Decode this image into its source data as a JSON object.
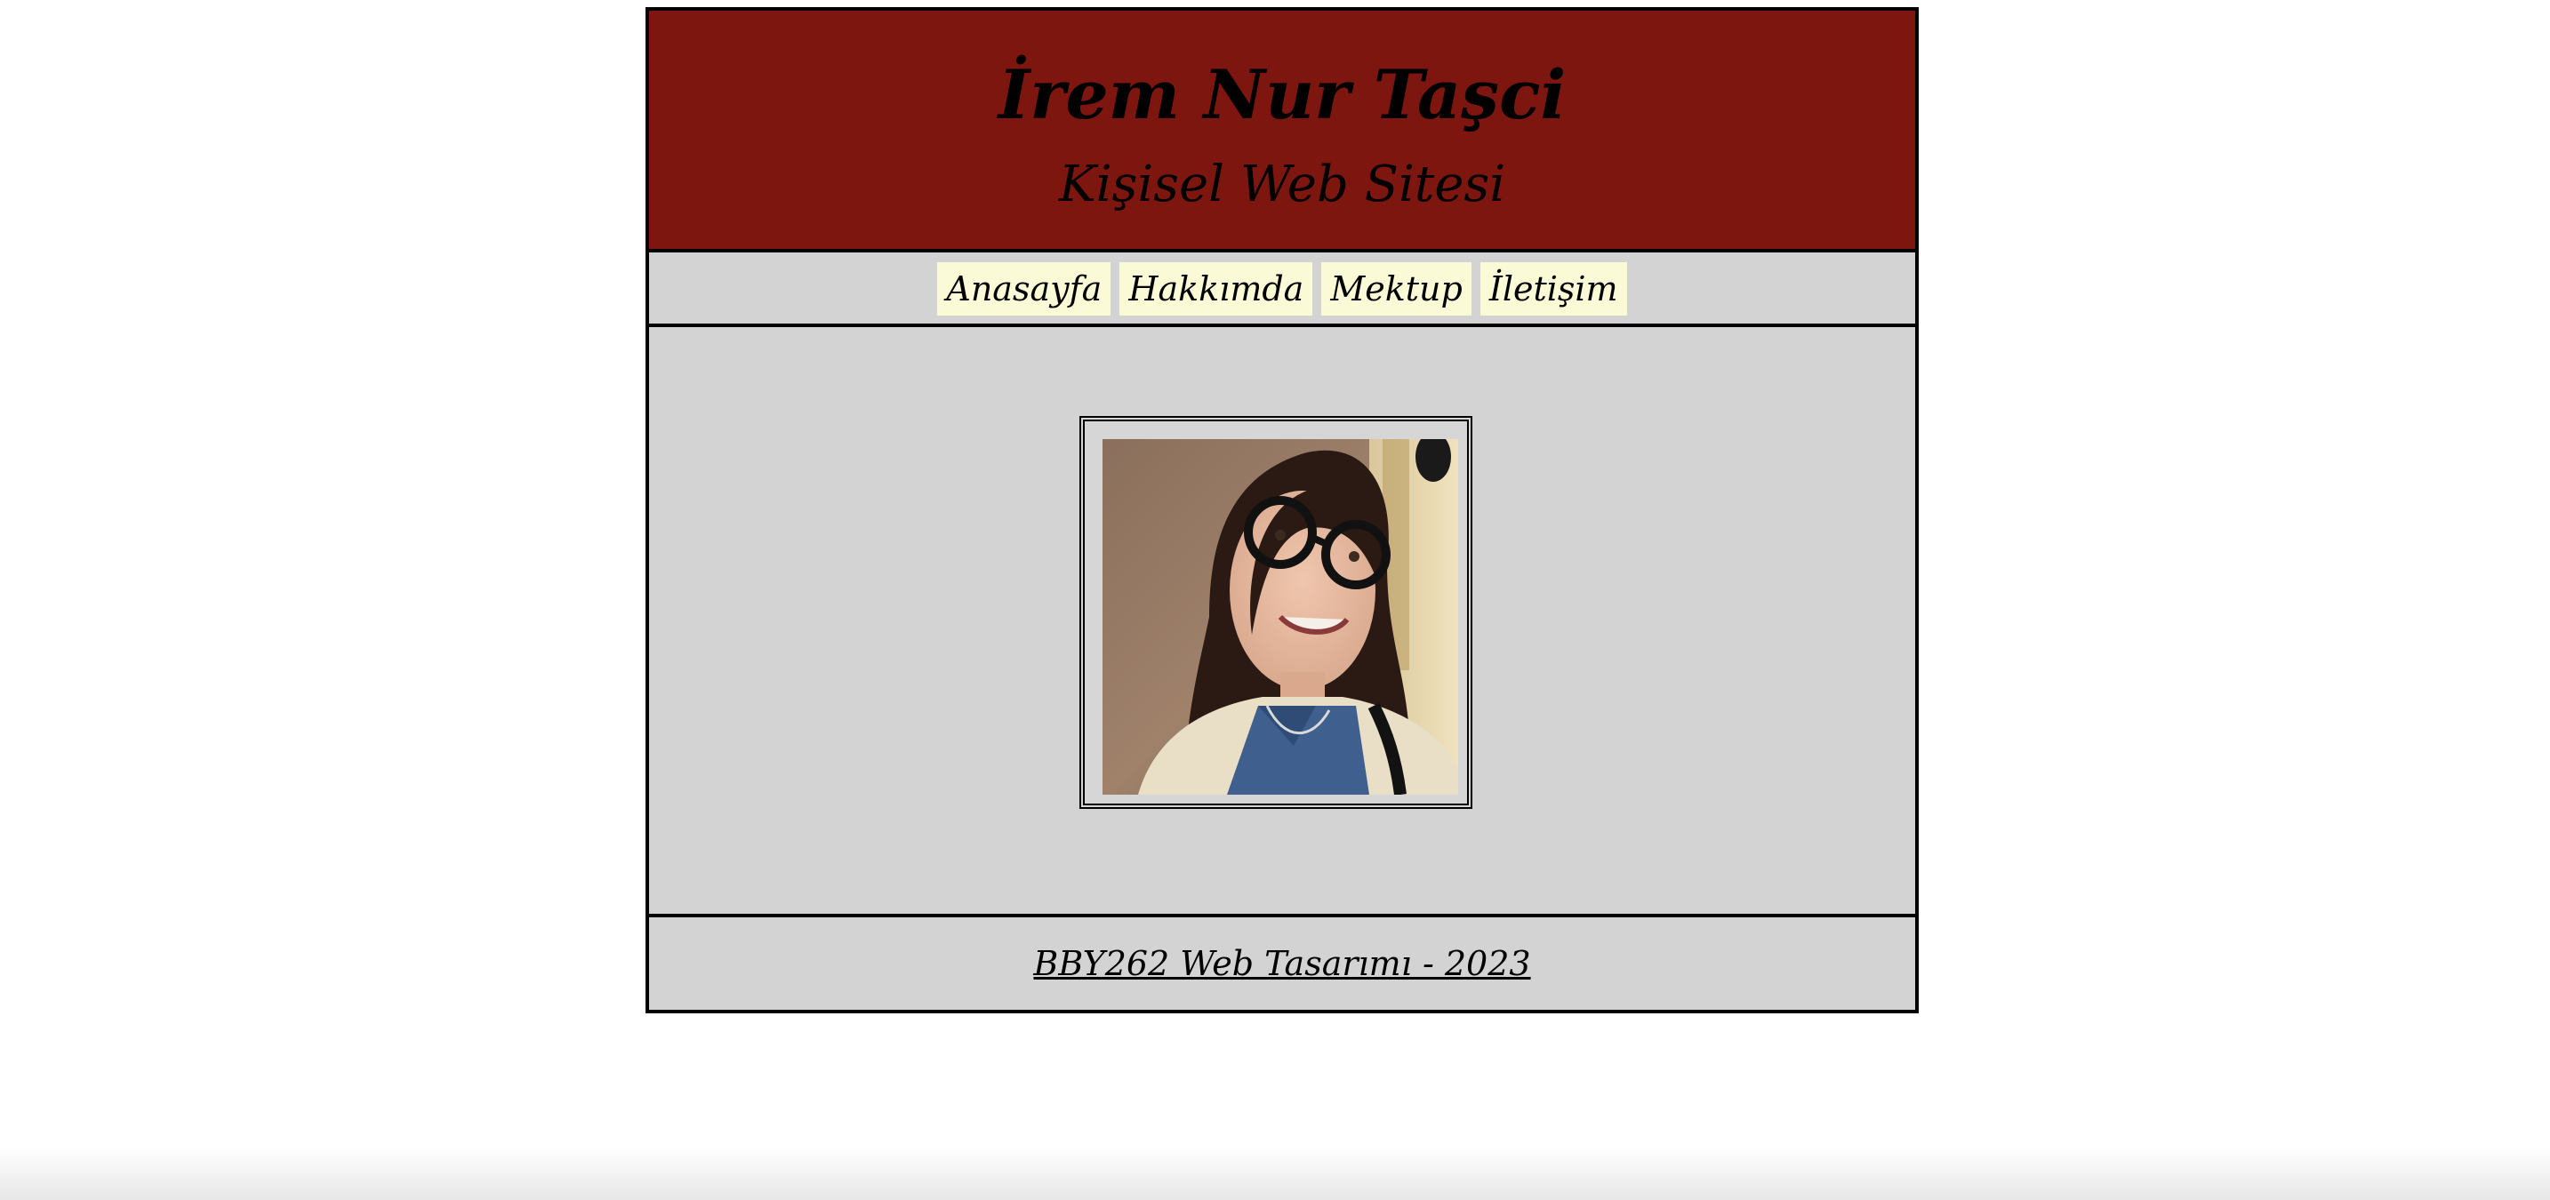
{
  "header": {
    "title": "İrem Nur Taşci",
    "subtitle": "Kişisel Web Sitesi"
  },
  "nav": {
    "items": [
      {
        "label": "Anasayfa"
      },
      {
        "label": "Hakkımda"
      },
      {
        "label": "Mektup"
      },
      {
        "label": "İletişim"
      }
    ]
  },
  "footer": {
    "text": "BBY262 Web Tasarımı - 2023"
  },
  "colors": {
    "header_bg": "#7e1610",
    "content_bg": "#d3d3d3",
    "nav_item_bg": "#fafad7",
    "border": "#000000"
  }
}
